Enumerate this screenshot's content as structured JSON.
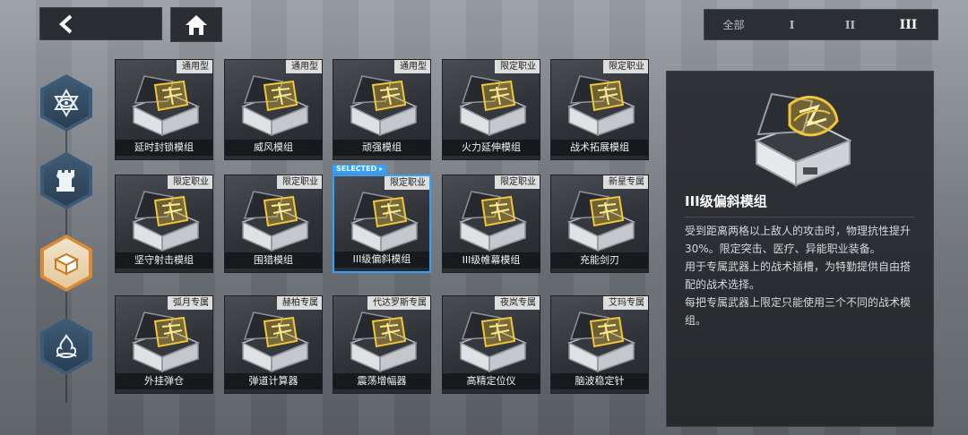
{
  "nav": {
    "back_icon": "back-chevron-icon",
    "home_icon": "home-icon"
  },
  "tiers": [
    "全部",
    "I",
    "II",
    "III"
  ],
  "active_tier": "III",
  "side_nav": [
    "emblem-icon",
    "chess-rook-icon",
    "module-box-icon",
    "flame-icon"
  ],
  "modules": [
    {
      "tag": "通用型",
      "name": "延时封锁模组"
    },
    {
      "tag": "通用型",
      "name": "威风模组"
    },
    {
      "tag": "通用型",
      "name": "顽强模组"
    },
    {
      "tag": "限定职业",
      "name": "火力延伸模组"
    },
    {
      "tag": "限定职业",
      "name": "战术拓展模组"
    },
    {
      "tag": "限定职业",
      "name": "坚守射击模组"
    },
    {
      "tag": "限定职业",
      "name": "围猎模组"
    },
    {
      "tag": "限定职业",
      "name": "III级偏斜模组"
    },
    {
      "tag": "限定职业",
      "name": "III级帷幕模组"
    },
    {
      "tag": "新星专属",
      "name": "充能剑刃"
    },
    {
      "tag": "弧月专属",
      "name": "外挂弹仓"
    },
    {
      "tag": "赫柏专属",
      "name": "弹道计算器"
    },
    {
      "tag": "代达罗斯专属",
      "name": "震荡增幅器"
    },
    {
      "tag": "夜岚专属",
      "name": "高精定位仪"
    },
    {
      "tag": "艾玛专属",
      "name": "脑波稳定针"
    }
  ],
  "selected_label": "SELECTED ▸",
  "detail": {
    "title": "III级偏斜模组",
    "desc1": "受到距离两格以上敌人的攻击时，物理抗性提升30%。限定突击、医疗、异能职业装备。",
    "desc2": "用于专属武器上的战术插槽，为特勤提供自由搭配的战术选择。",
    "desc3": "每把专属武器上限定只能使用三个不同的战术模组。"
  },
  "colors": {
    "accent_gold": "#f2c53a",
    "selected_blue": "#2fa3ff",
    "active_nav": "#d98a32"
  }
}
